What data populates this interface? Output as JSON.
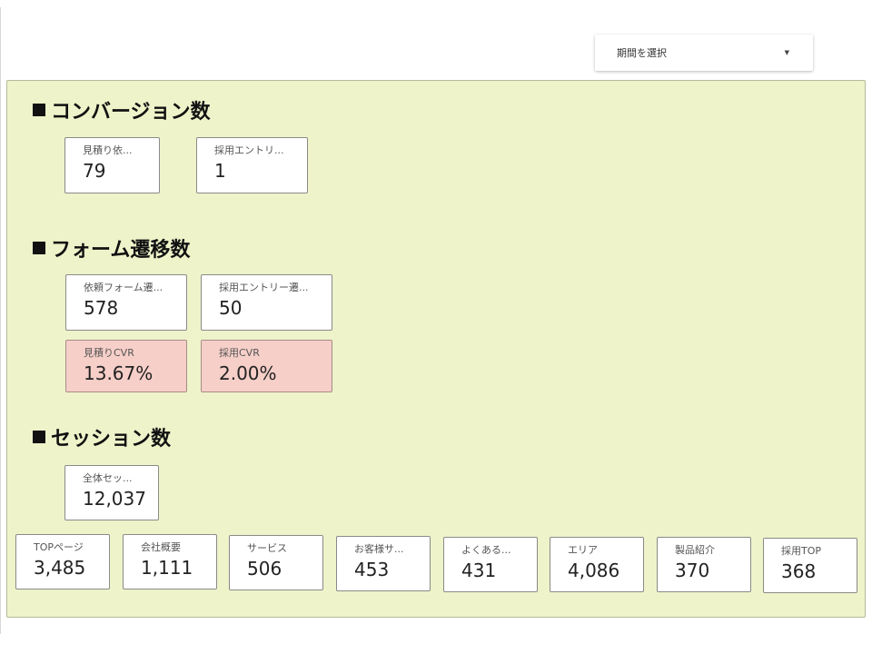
{
  "period_selector": {
    "label": "期間を選択",
    "caret": "▼"
  },
  "sections": {
    "conversions": {
      "title": "コンバージョン数"
    },
    "form_transitions": {
      "title": "フォーム遷移数"
    },
    "sessions": {
      "title": "セッション数"
    }
  },
  "conversion_cards": [
    {
      "label": "見積り依...",
      "value": "79"
    },
    {
      "label": "採用エントリ...",
      "value": "1"
    }
  ],
  "form_cards": [
    {
      "label": "依頼フォーム遷...",
      "value": "578"
    },
    {
      "label": "採用エントリー遷...",
      "value": "50"
    }
  ],
  "cvr_cards": [
    {
      "label": "見積りCVR",
      "value": "13.67%"
    },
    {
      "label": "採用CVR",
      "value": "2.00%"
    }
  ],
  "session_total": {
    "label": "全体セッ...",
    "value": "12,037"
  },
  "page_cards": [
    {
      "label": "TOPページ",
      "value": "3,485"
    },
    {
      "label": "会社概要",
      "value": "1,111"
    },
    {
      "label": "サービス",
      "value": "506"
    },
    {
      "label": "お客様サ...",
      "value": "453"
    },
    {
      "label": "よくある...",
      "value": "431"
    },
    {
      "label": "エリア",
      "value": "4,086"
    },
    {
      "label": "製品紹介",
      "value": "370"
    },
    {
      "label": "採用TOP",
      "value": "368"
    }
  ],
  "colors": {
    "panel_bg": "#eef3c9",
    "cvr_card_bg": "#f6cfc8"
  }
}
